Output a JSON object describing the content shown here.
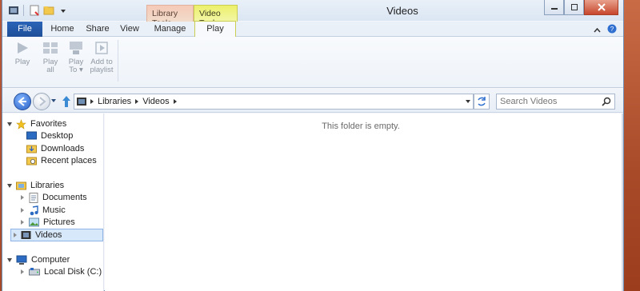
{
  "window": {
    "title": "Videos"
  },
  "context_tabs": {
    "library_tools": "Library Tools",
    "video_tools": "Video Tools"
  },
  "tabs": {
    "file": "File",
    "home": "Home",
    "share": "Share",
    "view": "View",
    "manage": "Manage",
    "play": "Play"
  },
  "ribbon": {
    "play": [
      "Play"
    ],
    "play_all": [
      "Play",
      "all"
    ],
    "play_to": [
      "Play",
      "To ▾"
    ],
    "add_to_playlist": [
      "Add to",
      "playlist"
    ]
  },
  "address": {
    "crumbs": [
      "Libraries",
      "Videos"
    ]
  },
  "search": {
    "placeholder": "Search Videos"
  },
  "nav": {
    "favorites": "Favorites",
    "desktop": "Desktop",
    "downloads": "Downloads",
    "recent_places": "Recent places",
    "libraries": "Libraries",
    "documents": "Documents",
    "music": "Music",
    "pictures": "Pictures",
    "videos": "Videos",
    "computer": "Computer",
    "local_disk": "Local Disk (C:)"
  },
  "content": {
    "empty_message": "This folder is empty."
  },
  "colors": {
    "accent": "#2a64b8",
    "selection": "#d8e8fb"
  }
}
